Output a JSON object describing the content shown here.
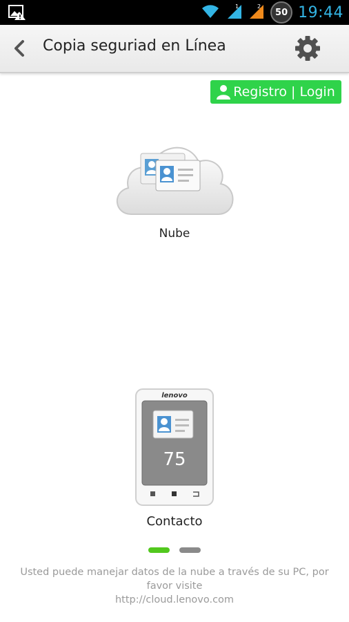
{
  "status_bar": {
    "time": "19:44",
    "badge": "50"
  },
  "header": {
    "title": "Copia seguriad en Línea"
  },
  "account": {
    "login_label": "Registro | Login"
  },
  "cloud": {
    "label": "Nube"
  },
  "device": {
    "brand": "lenovo",
    "count": "75",
    "label": "Contacto"
  },
  "pager": {
    "pages": 2,
    "active": 1
  },
  "footer": {
    "line1": "Usted puede manejar datos de la nube a través de su PC, por favor visite",
    "line2": "http://cloud.lenovo.com"
  },
  "colors": {
    "accent_green": "#2fd34a",
    "indicator_active": "#52c81e",
    "indicator_inactive": "#8a8a8a",
    "clock": "#33b5e5"
  }
}
